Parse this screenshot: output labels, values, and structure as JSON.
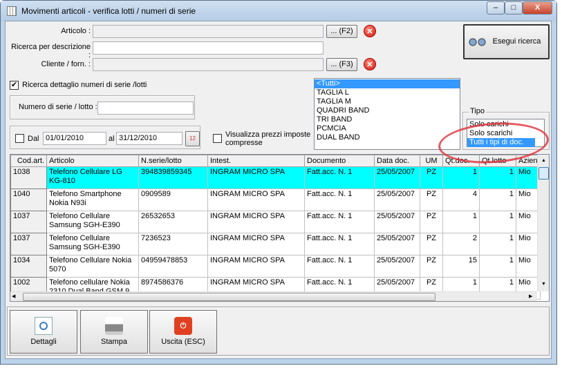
{
  "window": {
    "title": "Movimenti articoli - verifica lotti / numeri di serie",
    "minimize": "–",
    "maximize": "□",
    "close": "X"
  },
  "form": {
    "articolo_label": "Articolo :",
    "articolo_value": "",
    "f2_label": "... (F2)",
    "descrizione_label": "Ricerca per descrizione :",
    "descrizione_value": "",
    "cliente_label": "Cliente / forn. :",
    "cliente_value": "",
    "f3_label": "... (F3)",
    "dettaglio_label": "Ricerca dettaglio numeri di serie /lotti",
    "dettaglio_checked": "✔",
    "numero_label": "Numero di serie / lotto :",
    "numero_value": "",
    "dal_label": "Dal",
    "dal_value": "01/01/2010",
    "al_label": "al",
    "al_value": "31/12/2010",
    "prezzi_label_1": "Visualizza prezzi imposte",
    "prezzi_label_2": "compresse",
    "search_button": "Esegui ricerca"
  },
  "variants": [
    "<Tutti>",
    "TAGLIA L",
    "TAGLIA M",
    "QUADRI BAND",
    "TRI BAND",
    "PCMCIA",
    "DUAL BAND"
  ],
  "tipo": {
    "label": "Tipo",
    "options": [
      "Solo carichi",
      "Solo scarichi",
      "Tutti i tipi di doc."
    ]
  },
  "table": {
    "columns": [
      "Cod.art.",
      "Articolo",
      "N.serie/lotto",
      "Intest.",
      "Documento",
      "Data doc.",
      "UM",
      "Qt.doc.",
      "Qt.lotto",
      "Azien"
    ],
    "rows": [
      [
        "1038",
        "Telefono Cellulare LG KG-810",
        "394839859345",
        "INGRAM MICRO SPA",
        "Fatt.acc. N. 1",
        "25/05/2007",
        "PZ",
        "1",
        "1",
        "Mio"
      ],
      [
        "1040",
        "Telefono Smartphone Nokia N93i",
        "0909589",
        "INGRAM MICRO SPA",
        "Fatt.acc. N. 1",
        "25/05/2007",
        "PZ",
        "4",
        "1",
        "Mio"
      ],
      [
        "1037",
        "Telefono Cellulare Samsung SGH-E390",
        "26532653",
        "INGRAM MICRO SPA",
        "Fatt.acc. N. 1",
        "25/05/2007",
        "PZ",
        "1",
        "1",
        "Mio"
      ],
      [
        "1037",
        "Telefono Cellulare Samsung SGH-E390",
        "7236523",
        "INGRAM MICRO SPA",
        "Fatt.acc. N. 1",
        "25/05/2007",
        "PZ",
        "2",
        "1",
        "Mio"
      ],
      [
        "1034",
        "Telefono Cellulare Nokia 5070",
        "04959478853",
        "INGRAM MICRO SPA",
        "Fatt.acc. N. 1",
        "25/05/2007",
        "PZ",
        "15",
        "1",
        "Mio"
      ],
      [
        "1002",
        "Telefono cellulare Nokia 2310 Dual Band GSM 9",
        "8974586376",
        "INGRAM MICRO SPA",
        "Fatt.acc. N. 1",
        "25/05/2007",
        "PZ",
        "1",
        "1",
        "Mio"
      ]
    ]
  },
  "toolbar": {
    "details": "Dettagli",
    "print": "Stampa",
    "exit": "Uscita (ESC)"
  },
  "colors": {
    "selected_row": "#00ffff",
    "list_selection": "#3399ff",
    "annotation": "#e0303a"
  }
}
